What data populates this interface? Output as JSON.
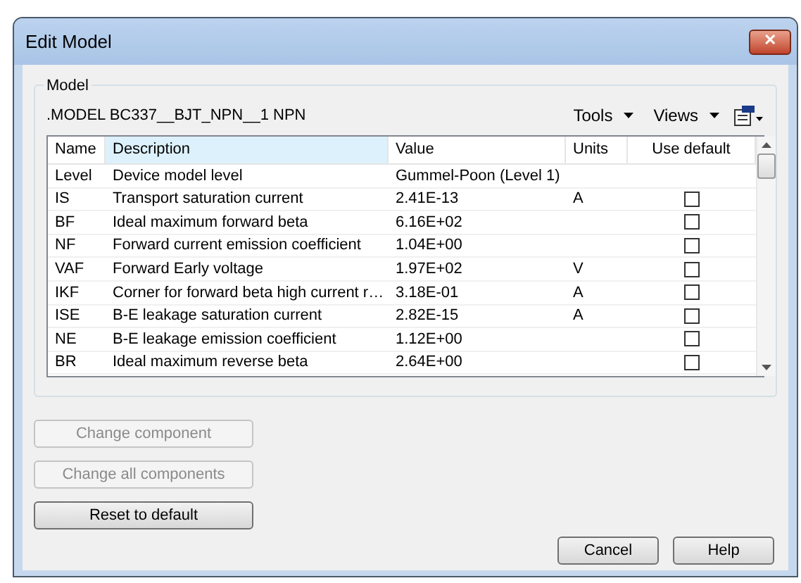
{
  "window": {
    "title": "Edit Model",
    "close": "✕"
  },
  "group": {
    "label": "Model",
    "model_line": ".MODEL BC337__BJT_NPN__1 NPN",
    "menus": [
      {
        "label": "Tools"
      },
      {
        "label": "Views"
      }
    ]
  },
  "table": {
    "columns": [
      {
        "label": "Name",
        "selected": false
      },
      {
        "label": "Description",
        "selected": true
      },
      {
        "label": "Value",
        "selected": false
      },
      {
        "label": "Units",
        "selected": false
      },
      {
        "label": "Use default",
        "selected": false
      }
    ],
    "rows": [
      {
        "name": "Level",
        "description": "Device model level",
        "value": "Gummel-Poon (Level 1)",
        "units": "",
        "kind": "text"
      },
      {
        "name": "IS",
        "description": "Transport saturation current",
        "value": "2.41E-13",
        "units": "A",
        "kind": "check",
        "checked": false
      },
      {
        "name": "BF",
        "description": "Ideal maximum forward beta",
        "value": "6.16E+02",
        "units": "",
        "kind": "check",
        "checked": false
      },
      {
        "name": "NF",
        "description": "Forward current emission coefficient",
        "value": "1.04E+00",
        "units": "",
        "kind": "check",
        "checked": false
      },
      {
        "name": "VAF",
        "description": "Forward Early voltage",
        "value": "1.97E+02",
        "units": "V",
        "kind": "check",
        "checked": false
      },
      {
        "name": "IKF",
        "description": "Corner for forward beta high current r…",
        "value": "3.18E-01",
        "units": "A",
        "kind": "check",
        "checked": false
      },
      {
        "name": "ISE",
        "description": "B-E leakage saturation current",
        "value": "2.82E-15",
        "units": "A",
        "kind": "check",
        "checked": false
      },
      {
        "name": "NE",
        "description": "B-E leakage emission coefficient",
        "value": "1.12E+00",
        "units": "",
        "kind": "check",
        "checked": false
      },
      {
        "name": "BR",
        "description": "Ideal maximum reverse beta",
        "value": "2.64E+00",
        "units": "",
        "kind": "check",
        "checked": false
      }
    ]
  },
  "side_buttons": [
    {
      "label": "Change component",
      "disabled": true
    },
    {
      "label": "Change all components",
      "disabled": true
    },
    {
      "label": "Reset to default",
      "disabled": false
    }
  ],
  "footer_buttons": [
    {
      "label": "Cancel"
    },
    {
      "label": "Help"
    }
  ]
}
